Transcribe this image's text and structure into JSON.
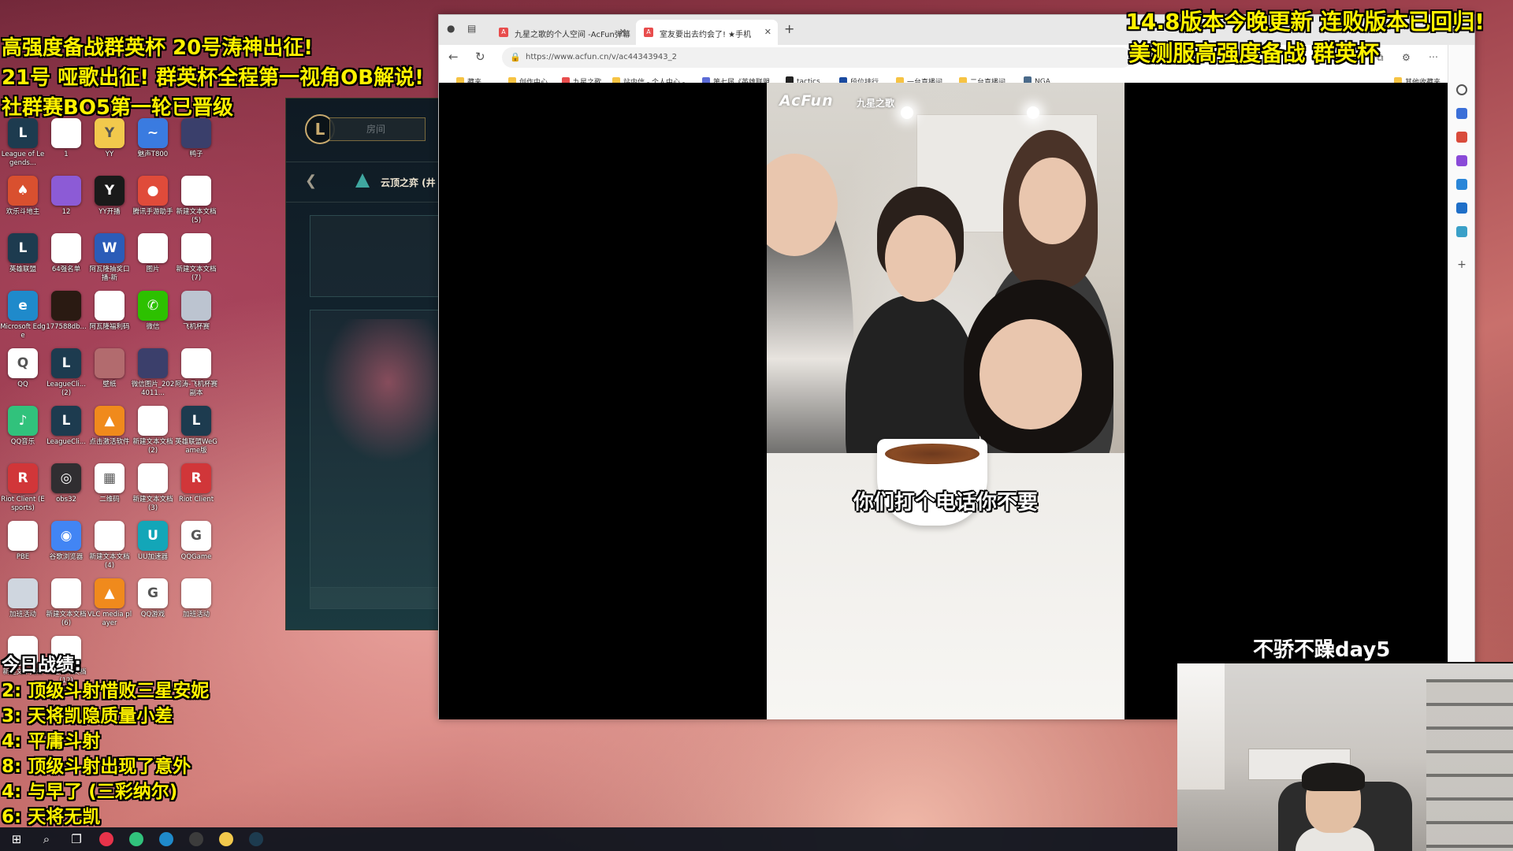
{
  "overlay": {
    "top_left": [
      "高强度备战群英杯 20号涛神出征!",
      "21号 哑歌出征! 群英杯全程第一视角OB解说!",
      "社群赛BO5第一轮已晋级"
    ],
    "top_right": [
      "14.8版本今晚更新 连败版本已回归!",
      "美测服高强度备战 群英杯"
    ],
    "day_label": "不骄不躁day5",
    "today_title": "今日战绩:",
    "today_records": [
      "2: 顶级斗射惜败三星安妮",
      "3: 天将凯隐质量小差",
      "4: 平庸斗射",
      "8: 顶级斗射出现了意外",
      "4: 与早了 (三彩纳尔)",
      "6: 天将无凯"
    ]
  },
  "desktop_icons": [
    {
      "label": "League of Legends...",
      "icon": "league-icon",
      "color": "#1d3b4f"
    },
    {
      "label": "1",
      "icon": "file-icon",
      "color": "#ffffff"
    },
    {
      "label": "YY",
      "icon": "yy-icon",
      "color": "#f2c94c"
    },
    {
      "label": "魅声T800",
      "icon": "audio-icon",
      "color": "#3a7be0"
    },
    {
      "label": "鸭子",
      "icon": "image-icon",
      "color": "#3a3f6b"
    },
    {
      "label": "欢乐斗地主",
      "icon": "cards-icon",
      "color": "#d9502f"
    },
    {
      "label": "12",
      "icon": "image-icon",
      "color": "#8c5bd6"
    },
    {
      "label": "YY开播",
      "icon": "yy-live-icon",
      "color": "#1a1a1a"
    },
    {
      "label": "腾讯手游助手",
      "icon": "tencent-icon",
      "color": "#e04b3a"
    },
    {
      "label": "新建文本文档 (5)",
      "icon": "text-file-icon",
      "color": "#ffffff"
    },
    {
      "label": "英雄联盟",
      "icon": "league-icon",
      "color": "#1d3b4f"
    },
    {
      "label": "64强名单",
      "icon": "file-icon",
      "color": "#ffffff"
    },
    {
      "label": "阿瓦隆抽奖口播-新",
      "icon": "word-icon",
      "color": "#2b5cb8"
    },
    {
      "label": "图片",
      "icon": "image-icon",
      "color": "#ffffff"
    },
    {
      "label": "新建文本文档 (7)",
      "icon": "text-file-icon",
      "color": "#ffffff"
    },
    {
      "label": "Microsoft Edge",
      "icon": "edge-icon",
      "color": "#1f8acb"
    },
    {
      "label": "177588db...",
      "icon": "image-icon",
      "color": "#2a1a12"
    },
    {
      "label": "阿瓦隆福利码",
      "icon": "text-file-icon",
      "color": "#ffffff"
    },
    {
      "label": "微信",
      "icon": "wechat-icon",
      "color": "#2dc100"
    },
    {
      "label": "飞机杯赛",
      "icon": "image-icon",
      "color": "#bcc4d0"
    },
    {
      "label": "QQ",
      "icon": "qq-icon",
      "color": "#ffffff"
    },
    {
      "label": "LeagueCli... (2)",
      "icon": "league-icon",
      "color": "#1d3b4f"
    },
    {
      "label": "壁纸",
      "icon": "image-icon",
      "color": "#b26b6e"
    },
    {
      "label": "微信图片_2024011...",
      "icon": "image-icon",
      "color": "#3b3f6b"
    },
    {
      "label": "阿涛-飞机杯赛副本",
      "icon": "text-file-icon",
      "color": "#ffffff"
    },
    {
      "label": "QQ音乐",
      "icon": "qq-music-icon",
      "color": "#31c27c"
    },
    {
      "label": "LeagueCli...",
      "icon": "league-icon",
      "color": "#1d3b4f"
    },
    {
      "label": "点击激活软件",
      "icon": "vlc-icon",
      "color": "#f08a1c"
    },
    {
      "label": "新建文本文档 (2)",
      "icon": "text-file-icon",
      "color": "#ffffff"
    },
    {
      "label": "英雄联盟WeGame版",
      "icon": "league-icon",
      "color": "#1d3b4f"
    },
    {
      "label": "Riot Client (Esports)",
      "icon": "riot-icon",
      "color": "#d13639"
    },
    {
      "label": "obs32",
      "icon": "obs-icon",
      "color": "#302e31"
    },
    {
      "label": "二维码",
      "icon": "qr-icon",
      "color": "#ffffff"
    },
    {
      "label": "新建文本文档 (3)",
      "icon": "text-file-icon",
      "color": "#ffffff"
    },
    {
      "label": "Riot Client",
      "icon": "riot-icon",
      "color": "#d13639"
    },
    {
      "label": "PBE",
      "icon": "file-icon",
      "color": "#ffffff"
    },
    {
      "label": "谷歌浏览器",
      "icon": "chrome-icon",
      "color": "#4285f4"
    },
    {
      "label": "新建文本文档 (4)",
      "icon": "text-file-icon",
      "color": "#ffffff"
    },
    {
      "label": "UU加速器",
      "icon": "uu-icon",
      "color": "#13a6b8"
    },
    {
      "label": "QQGame",
      "icon": "qqgame-icon",
      "color": "#ffffff"
    },
    {
      "label": "加班活动",
      "icon": "image-icon",
      "color": "#cfd6df"
    },
    {
      "label": "新建文本文档 (6)",
      "icon": "text-file-icon",
      "color": "#ffffff"
    },
    {
      "label": "VLC media player",
      "icon": "vlc-icon",
      "color": "#f08a1c"
    },
    {
      "label": "QQ游戏",
      "icon": "qqgame-icon",
      "color": "#ffffff"
    },
    {
      "label": "加班活动",
      "icon": "text-file-icon",
      "color": "#ffffff"
    },
    {
      "label": "新建文本文档",
      "icon": "text-file-icon",
      "color": "#ffffff"
    },
    {
      "label": "新建文本文档 (12)",
      "icon": "text-file-icon",
      "color": "#ffffff"
    }
  ],
  "game_client": {
    "room_placeholder": "房间",
    "mode_name": "云顶之弈 (井",
    "logo_letter": "L"
  },
  "browser": {
    "tabs": [
      {
        "title": "九星之歌的个人空间 -AcFun弹幕",
        "active": false
      },
      {
        "title": "室友要出去约会了! ★手机",
        "active": true
      }
    ],
    "url": "https://www.acfun.cn/v/ac44343943_2",
    "bookmarks": [
      {
        "label": "藏夹",
        "color": "#f6c343"
      },
      {
        "label": "创作中心",
        "color": "#f6c343"
      },
      {
        "label": "九星之歌",
        "color": "#e84d4d"
      },
      {
        "label": "站内信 - 个人中心 -...",
        "color": "#f6c343"
      },
      {
        "label": "第七届《英雄联盟...",
        "color": "#5b6bd6"
      },
      {
        "label": "tactics",
        "color": "#222222"
      },
      {
        "label": "段位排行",
        "color": "#1a4aa0"
      },
      {
        "label": "一台直播间",
        "color": "#f6c343"
      },
      {
        "label": "二台直播间",
        "color": "#f6c343"
      },
      {
        "label": "NGA",
        "color": "#4a6a8a"
      },
      {
        "label": "其他收藏夹",
        "color": "#f6c343"
      }
    ],
    "video": {
      "logo": "AcFun",
      "channel": "九星之歌",
      "subtitle": "你们打个电话你不要"
    }
  },
  "taskbar": {
    "icons": [
      "windows-start-icon",
      "search-icon",
      "task-view-icon",
      "netease-music-icon",
      "qq-music-icon",
      "edge-icon",
      "obs-icon",
      "yy-icon",
      "league-icon"
    ]
  }
}
